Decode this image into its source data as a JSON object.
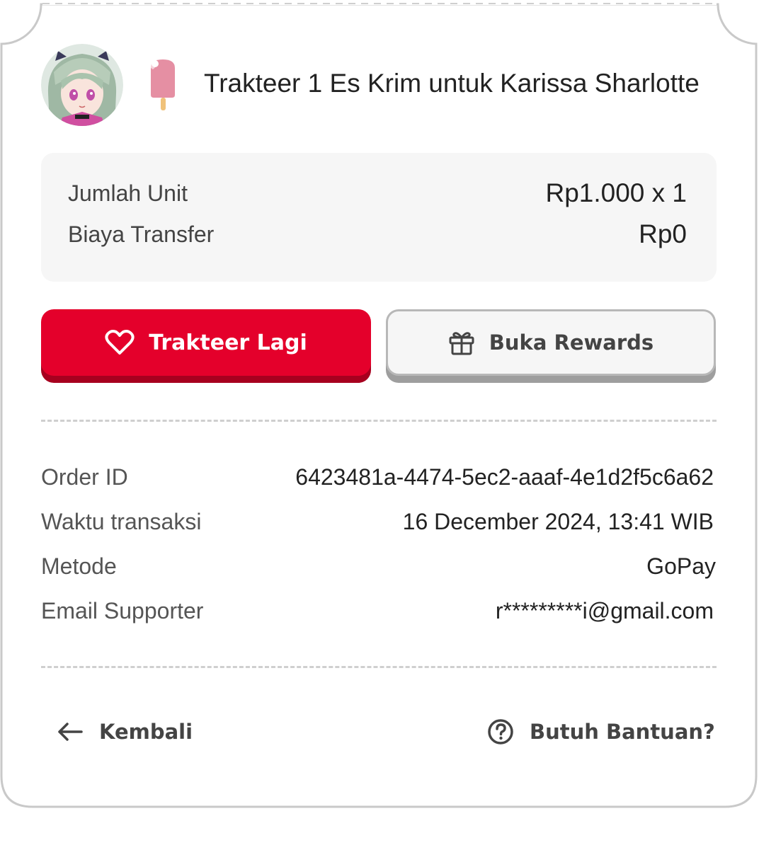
{
  "header": {
    "title": "Trakteer 1 Es Krim untuk Karissa Sharlotte",
    "avatar_icon": "avatar-anime-girl",
    "item_icon": "popsicle-icon"
  },
  "summary": {
    "rows": [
      {
        "label": "Jumlah Unit",
        "value": "Rp1.000 x 1"
      },
      {
        "label": "Biaya Transfer",
        "value": "Rp0"
      }
    ]
  },
  "actions": {
    "primary": {
      "label": "Trakteer Lagi",
      "icon": "heart-icon",
      "color": "#e4002b"
    },
    "secondary": {
      "label": "Buka Rewards",
      "icon": "gift-icon"
    }
  },
  "details": {
    "rows": [
      {
        "label": "Order ID",
        "value": "6423481a-4474-5ec2-aaaf-4e1d2f5c6a62"
      },
      {
        "label": "Waktu transaksi",
        "value": "16 December 2024, 13:41 WIB"
      },
      {
        "label": "Metode",
        "value": "GoPay"
      },
      {
        "label": "Email Supporter",
        "value": "r*********i@gmail.com"
      }
    ]
  },
  "footer": {
    "back_label": "Kembali",
    "help_label": "Butuh Bantuan?"
  }
}
